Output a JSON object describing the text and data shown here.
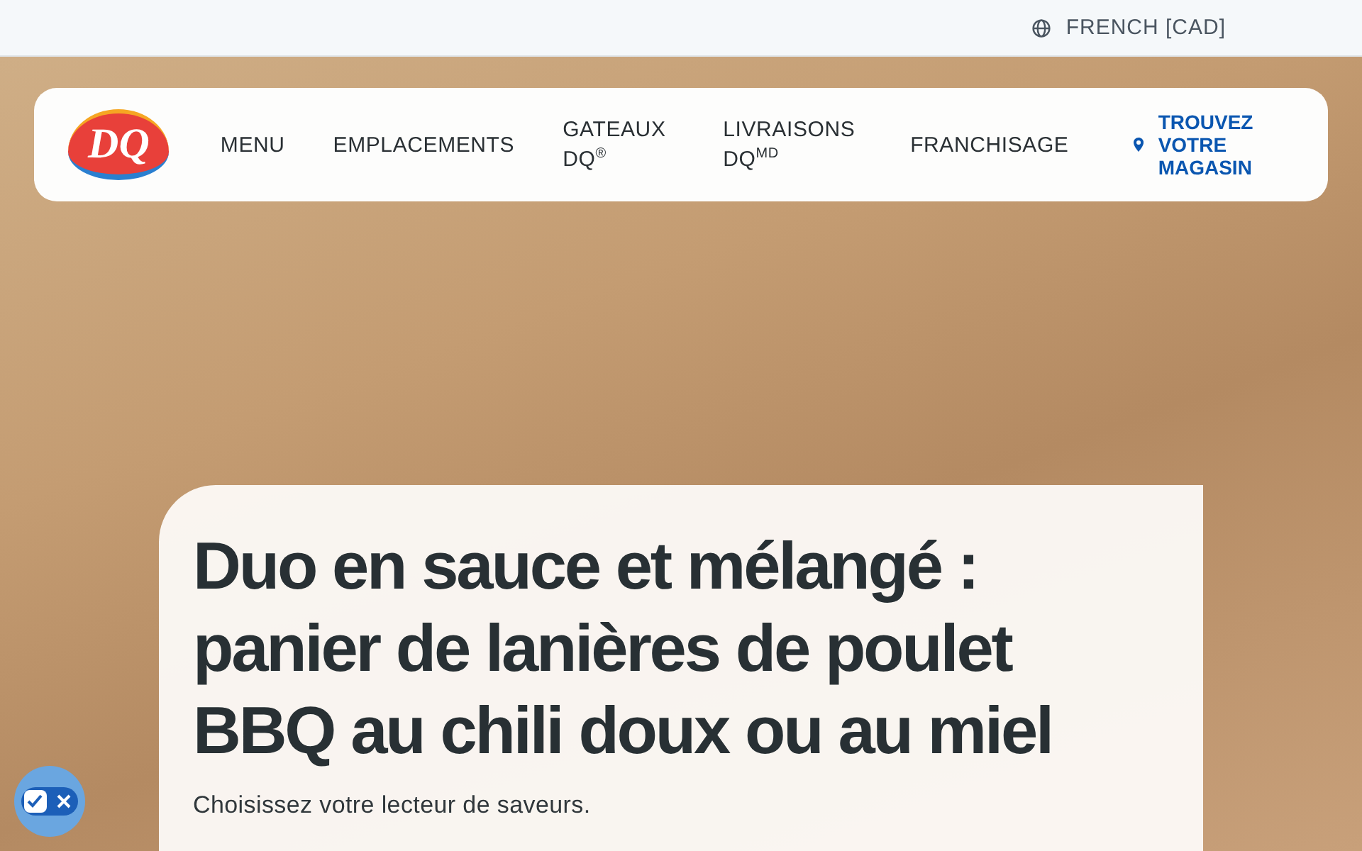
{
  "top_bar": {
    "language": "FRENCH [CAD]"
  },
  "nav": {
    "logo": "DQ",
    "items": [
      {
        "label": "MENU"
      },
      {
        "label": "EMPLACEMENTS"
      },
      {
        "label": "GATEAUX DQ$^{®}$"
      },
      {
        "label": "LIVRAISONS DQ$^{MD}$"
      },
      {
        "label": "FRANCHISAGE"
      }
    ],
    "store_link": "TROUVEZ VOTRE MAGASIN"
  },
  "hero": {
    "title": "Duo en sauce et mélangé : panier de lanières de poulet BBQ au chili doux ou au miel",
    "subtitle": "Choisissez votre lecteur de saveurs."
  },
  "privacy_toggle": {
    "on": true
  }
}
